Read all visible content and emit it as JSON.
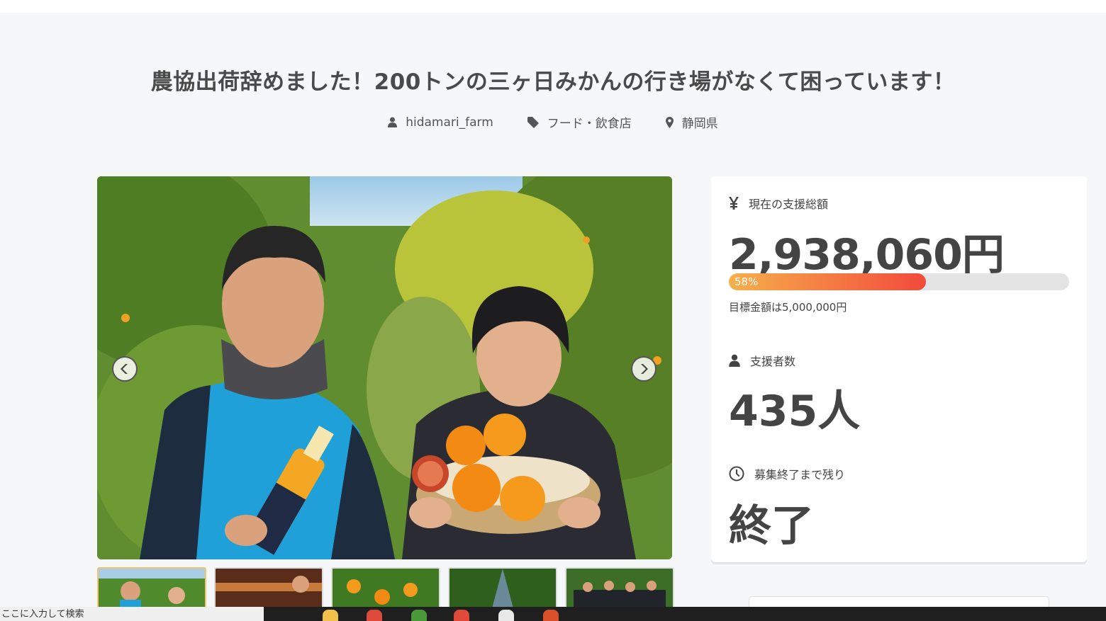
{
  "project": {
    "title": "農協出荷辞めました！200トンの三ヶ日みかんの行き場がなくて困っています！",
    "owner": "hidamari_farm",
    "category": "フード・飲食店",
    "location": "静岡県"
  },
  "stats": {
    "amount_label": "現在の支援総額",
    "amount": "2,938,060円",
    "progress_percent": 58,
    "progress_text": "58%",
    "goal_text": "目標金額は5,000,000円",
    "supporters_label": "支援者数",
    "supporters": "435人",
    "remaining_label": "募集終了まで残り",
    "remaining": "終了"
  },
  "icons": {
    "owner": "user-icon",
    "category": "tag-icon",
    "location": "map-pin-icon",
    "amount": "yen-icon",
    "supporters": "user-icon",
    "remaining": "clock-icon"
  },
  "gallery": {
    "thumbnail_count": 5,
    "active_index": 0
  },
  "taskbar": {
    "search_text": "ここに入力して検索"
  },
  "colors": {
    "progress_start": "#f6b04b",
    "progress_end": "#f24a3c",
    "thumb_active_border": "#f5c56b"
  }
}
